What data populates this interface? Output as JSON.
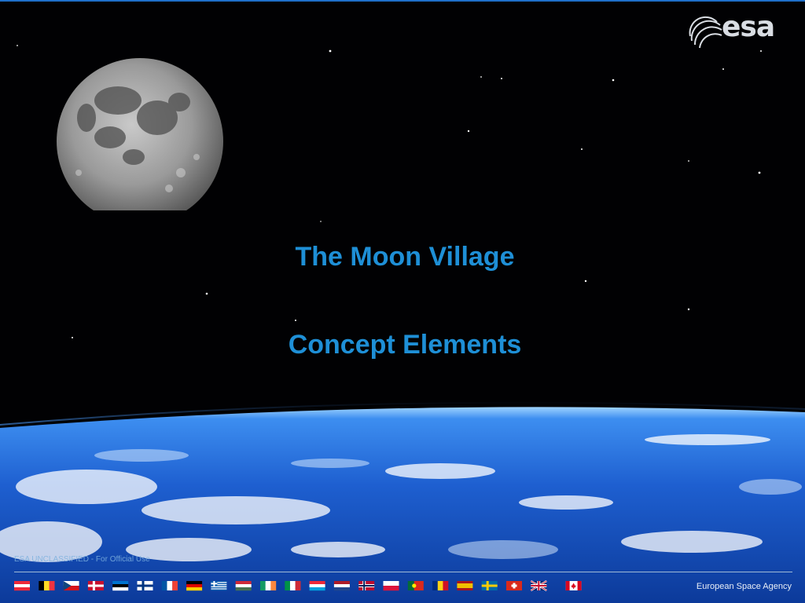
{
  "slide": {
    "title_line1": "The Moon Village",
    "title_line2": "Concept Elements",
    "logo_text": "esa",
    "classification": "ESA UNCLASSIFIED - For Official Use",
    "agency_name": "European Space Agency"
  },
  "flags": [
    {
      "name": "austria-flag",
      "colors": [
        "#ed2939",
        "#ffffff",
        "#ed2939"
      ],
      "layout": "h"
    },
    {
      "name": "belgium-flag",
      "colors": [
        "#000000",
        "#fdda24",
        "#ef3340"
      ],
      "layout": "v"
    },
    {
      "name": "czech-flag",
      "colors": [
        "#ffffff",
        "#d7141a",
        "#11457e"
      ],
      "layout": "czech"
    },
    {
      "name": "denmark-flag",
      "colors": [
        "#c8102e",
        "#ffffff"
      ],
      "layout": "nordic"
    },
    {
      "name": "estonia-flag",
      "colors": [
        "#0072ce",
        "#000000",
        "#ffffff"
      ],
      "layout": "h"
    },
    {
      "name": "finland-flag",
      "colors": [
        "#ffffff",
        "#003580"
      ],
      "layout": "nordic"
    },
    {
      "name": "france-flag",
      "colors": [
        "#0055a4",
        "#ffffff",
        "#ef4135"
      ],
      "layout": "v"
    },
    {
      "name": "germany-flag",
      "colors": [
        "#000000",
        "#dd0000",
        "#ffce00"
      ],
      "layout": "h"
    },
    {
      "name": "greece-flag",
      "colors": [
        "#0d5eaf",
        "#ffffff"
      ],
      "layout": "stripes"
    },
    {
      "name": "hungary-flag",
      "colors": [
        "#ce2939",
        "#ffffff",
        "#477050"
      ],
      "layout": "h"
    },
    {
      "name": "ireland-flag",
      "colors": [
        "#169b62",
        "#ffffff",
        "#ff883e"
      ],
      "layout": "v"
    },
    {
      "name": "italy-flag",
      "colors": [
        "#009246",
        "#ffffff",
        "#ce2b37"
      ],
      "layout": "v"
    },
    {
      "name": "luxembourg-flag",
      "colors": [
        "#ed2939",
        "#ffffff",
        "#00a1de"
      ],
      "layout": "h"
    },
    {
      "name": "netherlands-flag",
      "colors": [
        "#ae1c28",
        "#ffffff",
        "#21468b"
      ],
      "layout": "h"
    },
    {
      "name": "norway-flag",
      "colors": [
        "#ba0c2f",
        "#ffffff",
        "#00205b"
      ],
      "layout": "nordic2"
    },
    {
      "name": "poland-flag",
      "colors": [
        "#ffffff",
        "#dc143c"
      ],
      "layout": "h"
    },
    {
      "name": "portugal-flag",
      "colors": [
        "#046a38",
        "#da291c",
        "#ffe900"
      ],
      "layout": "portugal"
    },
    {
      "name": "romania-flag",
      "colors": [
        "#002b7f",
        "#fcd116",
        "#ce1126"
      ],
      "layout": "v"
    },
    {
      "name": "spain-flag",
      "colors": [
        "#aa151b",
        "#f1bf00",
        "#aa151b"
      ],
      "layout": "spain"
    },
    {
      "name": "sweden-flag",
      "colors": [
        "#006aa7",
        "#fecc00"
      ],
      "layout": "nordic"
    },
    {
      "name": "switzerland-flag",
      "colors": [
        "#da291c",
        "#ffffff"
      ],
      "layout": "swiss"
    },
    {
      "name": "uk-flag",
      "colors": [
        "#012169",
        "#ffffff",
        "#c8102e"
      ],
      "layout": "uk"
    },
    {
      "name": "canada-flag",
      "colors": [
        "#d80621",
        "#ffffff"
      ],
      "layout": "canada"
    }
  ]
}
